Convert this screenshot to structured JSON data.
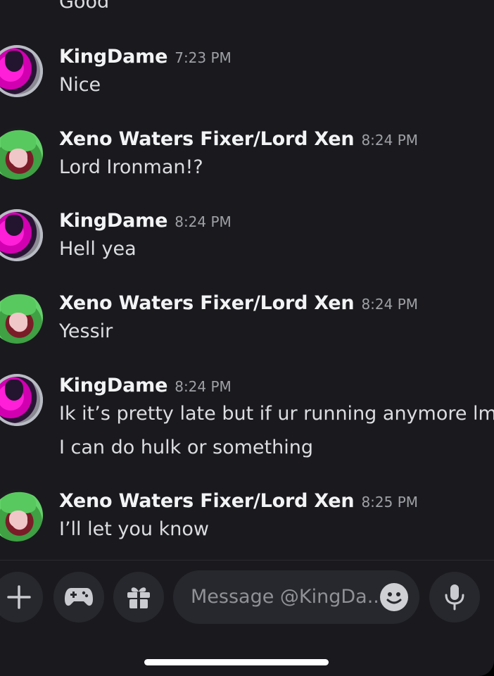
{
  "chat": {
    "previous_text": "Good",
    "messages": [
      {
        "author": "KingDame",
        "avatar": "kingdame-avatar",
        "time": "7:23 PM",
        "lines": [
          "Nice"
        ]
      },
      {
        "author": "Xeno Waters Fixer/Lord Xen",
        "avatar": "xeno-avatar",
        "time": "8:24 PM",
        "lines": [
          "Lord Ironman!?"
        ]
      },
      {
        "author": "KingDame",
        "avatar": "kingdame-avatar",
        "time": "8:24 PM",
        "lines": [
          "Hell yea"
        ]
      },
      {
        "author": "Xeno Waters Fixer/Lord Xen",
        "avatar": "xeno-avatar",
        "time": "8:24 PM",
        "lines": [
          "Yessir"
        ]
      },
      {
        "author": "KingDame",
        "avatar": "kingdame-avatar",
        "time": "8:24 PM",
        "lines": [
          "Ik it’s pretty late but if ur running anymore lmk",
          "I can do hulk or something"
        ]
      },
      {
        "author": "Xeno Waters Fixer/Lord Xen",
        "avatar": "xeno-avatar",
        "time": "8:25 PM",
        "lines": [
          "I’ll let you know"
        ]
      }
    ]
  },
  "composer": {
    "placeholder": "Message @KingDa...",
    "icons": [
      "plus-icon",
      "gamepad-icon",
      "gift-icon",
      "emoji-icon",
      "microphone-icon"
    ]
  }
}
